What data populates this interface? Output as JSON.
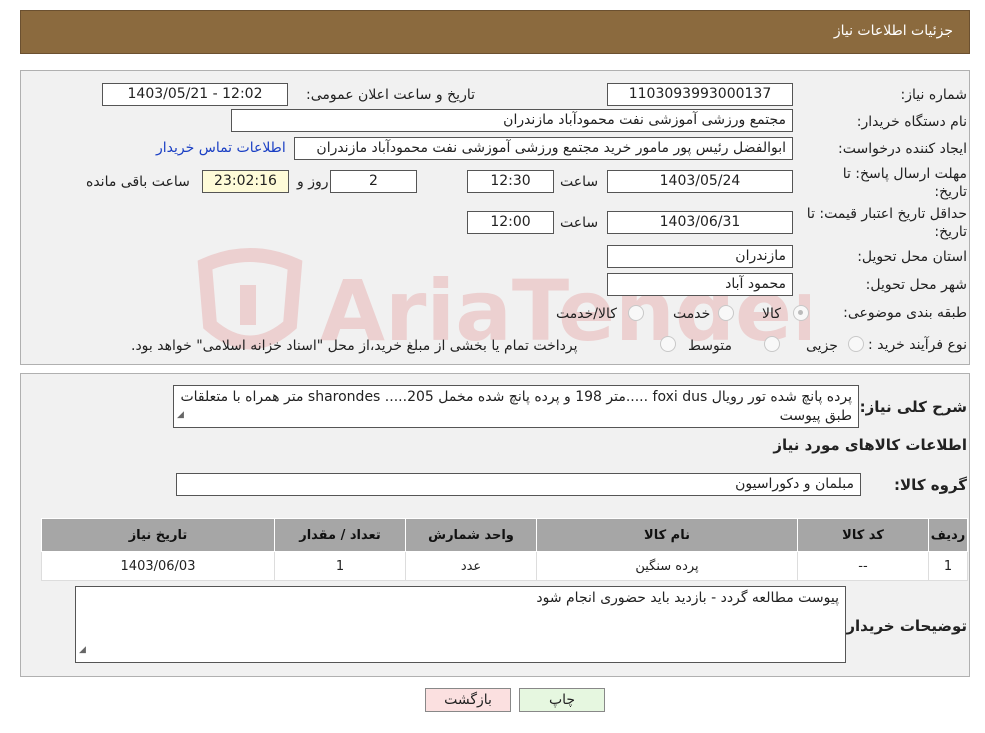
{
  "header": {
    "title": "جزئیات اطلاعات نیاز"
  },
  "form": {
    "need_number_label": "شماره نیاز:",
    "need_number": "1103093993000137",
    "announce_label": "تاریخ و ساعت اعلان عمومی:",
    "announce_value": "1403/05/21 - 12:02",
    "buyer_org_label": "نام دستگاه خریدار:",
    "buyer_org": "مجتمع ورزشی آموزشی نفت محمودآباد مازندران",
    "creator_label": "ایجاد کننده درخواست:",
    "creator": "ابوالفضل رئیس پور مامور خرید مجتمع ورزشی آموزشی نفت محمودآباد مازندران",
    "contact_link": "اطلاعات تماس خریدار",
    "deadline_label_1": "مهلت ارسال پاسخ: تا",
    "deadline_label_2": "تاریخ:",
    "deadline_date": "1403/05/24",
    "time_label": "ساعت",
    "deadline_time": "12:30",
    "days_value": "2",
    "days_label": "روز و",
    "remaining_time": "23:02:16",
    "remaining_label": "ساعت باقی مانده",
    "validity_label_1": "حداقل تاریخ اعتبار قیمت: تا",
    "validity_label_2": "تاریخ:",
    "validity_date": "1403/06/31",
    "validity_time": "12:00",
    "province_label": "استان محل تحویل:",
    "province": "مازندران",
    "city_label": "شهر محل تحویل:",
    "city": "محمود آباد",
    "category_label": "طبقه بندی موضوعی:",
    "category_options": [
      "کالا",
      "خدمت",
      "کالا/خدمت"
    ],
    "process_label": "نوع فرآیند خرید :",
    "process_options": [
      "جزیی",
      "متوسط"
    ],
    "process_note": "پرداخت تمام یا بخشی از مبلغ خرید،از محل \"اسناد خزانه اسلامی\" خواهد بود."
  },
  "details": {
    "summary_label": "شرح کلی نیاز:",
    "summary_text": "پرده پانچ شده تور رویال  foxi dus .....متر 198 و پرده پانچ شده مخمل 205..... sharondes متر همراه با متعلقات طبق پیوست",
    "goods_info_title": "اطلاعات کالاهای مورد نیاز",
    "group_label": "گروه کالا:",
    "group_value": "مبلمان و دکوراسیون",
    "table_headers": [
      "ردیف",
      "کد کالا",
      "نام کالا",
      "واحد شمارش",
      "تعداد / مقدار",
      "تاریخ نیاز"
    ],
    "table_rows": [
      [
        "1",
        "--",
        "پرده سنگین",
        "عدد",
        "1",
        "1403/06/03"
      ]
    ],
    "buyer_notes_label": "توضیحات خریدار:",
    "buyer_notes": "پیوست مطالعه گردد - بازدید باید حضوری انجام شود"
  },
  "buttons": {
    "back": "بازگشت",
    "print": "چاپ"
  },
  "watermark": {
    "text": "AriaTender.neT"
  },
  "colors": {
    "header_bg": "#8b6a3e",
    "back_btn_bg": "#fbe0e0",
    "print_btn_bg": "#e6f7e0",
    "link": "#1a3fc4"
  }
}
